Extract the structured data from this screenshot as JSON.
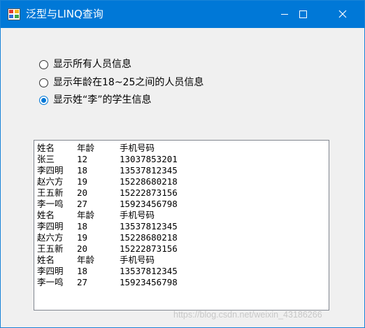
{
  "window": {
    "title": "泛型与LINQ查询",
    "controls": {
      "minimize_icon": "minimize-icon",
      "maximize_icon": "maximize-icon",
      "close_icon": "close-icon"
    }
  },
  "options": [
    {
      "label": "显示所有人员信息",
      "checked": false
    },
    {
      "label": "显示年龄在18~25之间的人员信息",
      "checked": false
    },
    {
      "label": "显示姓“李”的学生信息",
      "checked": true
    }
  ],
  "list": {
    "rows": [
      {
        "name": "姓名",
        "age": "年龄",
        "phone": "手机号码"
      },
      {
        "name": "张三",
        "age": "12",
        "phone": "13037853201"
      },
      {
        "name": "李四明",
        "age": "18",
        "phone": "13537812345"
      },
      {
        "name": "赵六方",
        "age": "19",
        "phone": "15228680218"
      },
      {
        "name": "王五新",
        "age": "20",
        "phone": "15222873156"
      },
      {
        "name": "李一鸣",
        "age": "27",
        "phone": "15923456798"
      },
      {
        "name": "姓名",
        "age": "年龄",
        "phone": "手机号码"
      },
      {
        "name": "李四明",
        "age": "18",
        "phone": "13537812345"
      },
      {
        "name": "赵六方",
        "age": "19",
        "phone": "15228680218"
      },
      {
        "name": "王五新",
        "age": "20",
        "phone": "15222873156"
      },
      {
        "name": "姓名",
        "age": "年龄",
        "phone": "手机号码"
      },
      {
        "name": "李四明",
        "age": "18",
        "phone": "13537812345"
      },
      {
        "name": "李一鸣",
        "age": "27",
        "phone": "15923456798"
      }
    ]
  },
  "watermark": "https://blog.csdn.net/weixin_43186266",
  "colors": {
    "titlebar": "#0078d7",
    "radio_checked": "#0078d7",
    "window_bg": "#f0f0f0"
  }
}
